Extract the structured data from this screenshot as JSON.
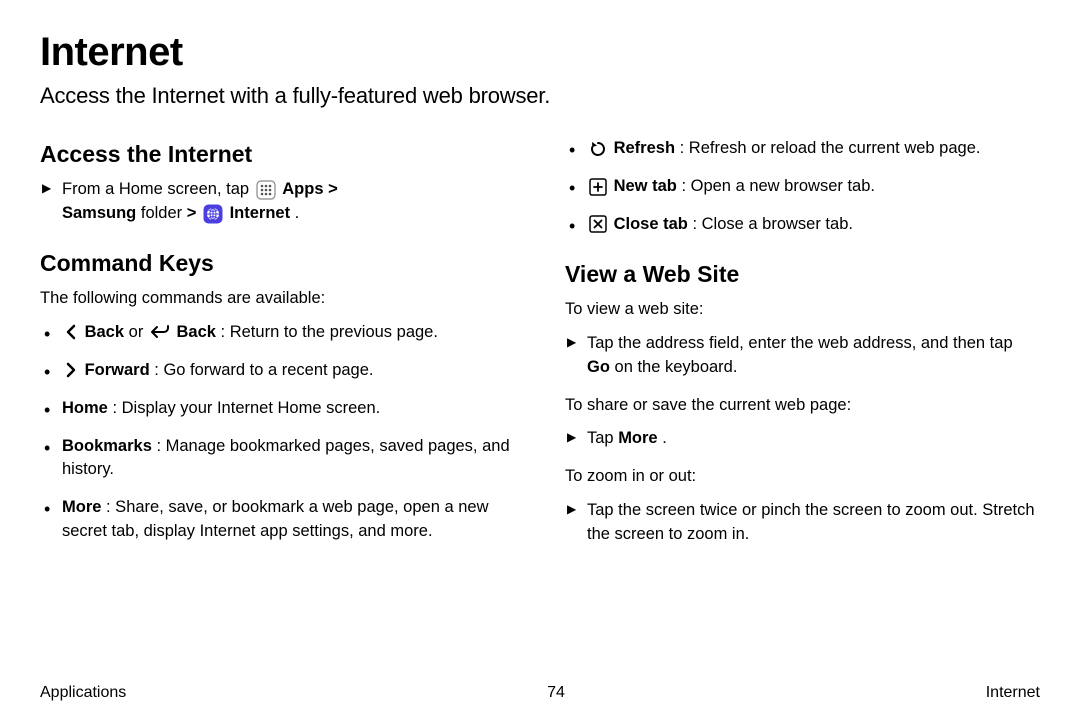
{
  "title": "Internet",
  "subtitle": "Access the Internet with a fully-featured web browser.",
  "left": {
    "access_heading": "Access the Internet",
    "access_step_prefix": "From a Home screen, tap ",
    "access_apps_label": "Apps",
    "access_samsung_label": "Samsung",
    "access_folder_label": " folder ",
    "access_internet_label": "Internet",
    "access_sep": " > ",
    "access_period": " .",
    "command_heading": "Command Keys",
    "command_intro": "The following commands are available:",
    "back_label": "Back",
    "back_or": "  or ",
    "back_desc": " : Return to the previous page.",
    "forward_label": "Forward",
    "forward_desc": " : Go forward to a recent page.",
    "home_label": "Home",
    "home_desc": ": Display your Internet Home screen.",
    "bookmarks_label": "Bookmarks",
    "bookmarks_desc": ": Manage bookmarked pages, saved pages, and history.",
    "more_label": "More",
    "more_desc": ": Share, save, or bookmark a web page, open a new secret tab, display Internet app settings, and more."
  },
  "right": {
    "refresh_label": "Refresh",
    "refresh_desc": " : Refresh or reload the current web page.",
    "newtab_label": "New tab",
    "newtab_desc": " : Open a new browser tab.",
    "closetab_label": "Close tab",
    "closetab_desc": " : Close a browser tab.",
    "view_heading": "View a Web Site",
    "view_intro": "To view a web site:",
    "view_step1_a": "Tap the address field, enter the web address, and then tap ",
    "view_step1_go": "Go",
    "view_step1_b": " on the keyboard.",
    "share_intro": "To share or save the current web page:",
    "share_step_a": "Tap ",
    "share_step_more": "More",
    "share_step_b": ".",
    "zoom_intro": "To zoom in or out:",
    "zoom_step": "Tap the screen twice or pinch the screen to zoom out. Stretch the screen to zoom in."
  },
  "footer": {
    "left": "Applications",
    "center": "74",
    "right": "Internet"
  }
}
